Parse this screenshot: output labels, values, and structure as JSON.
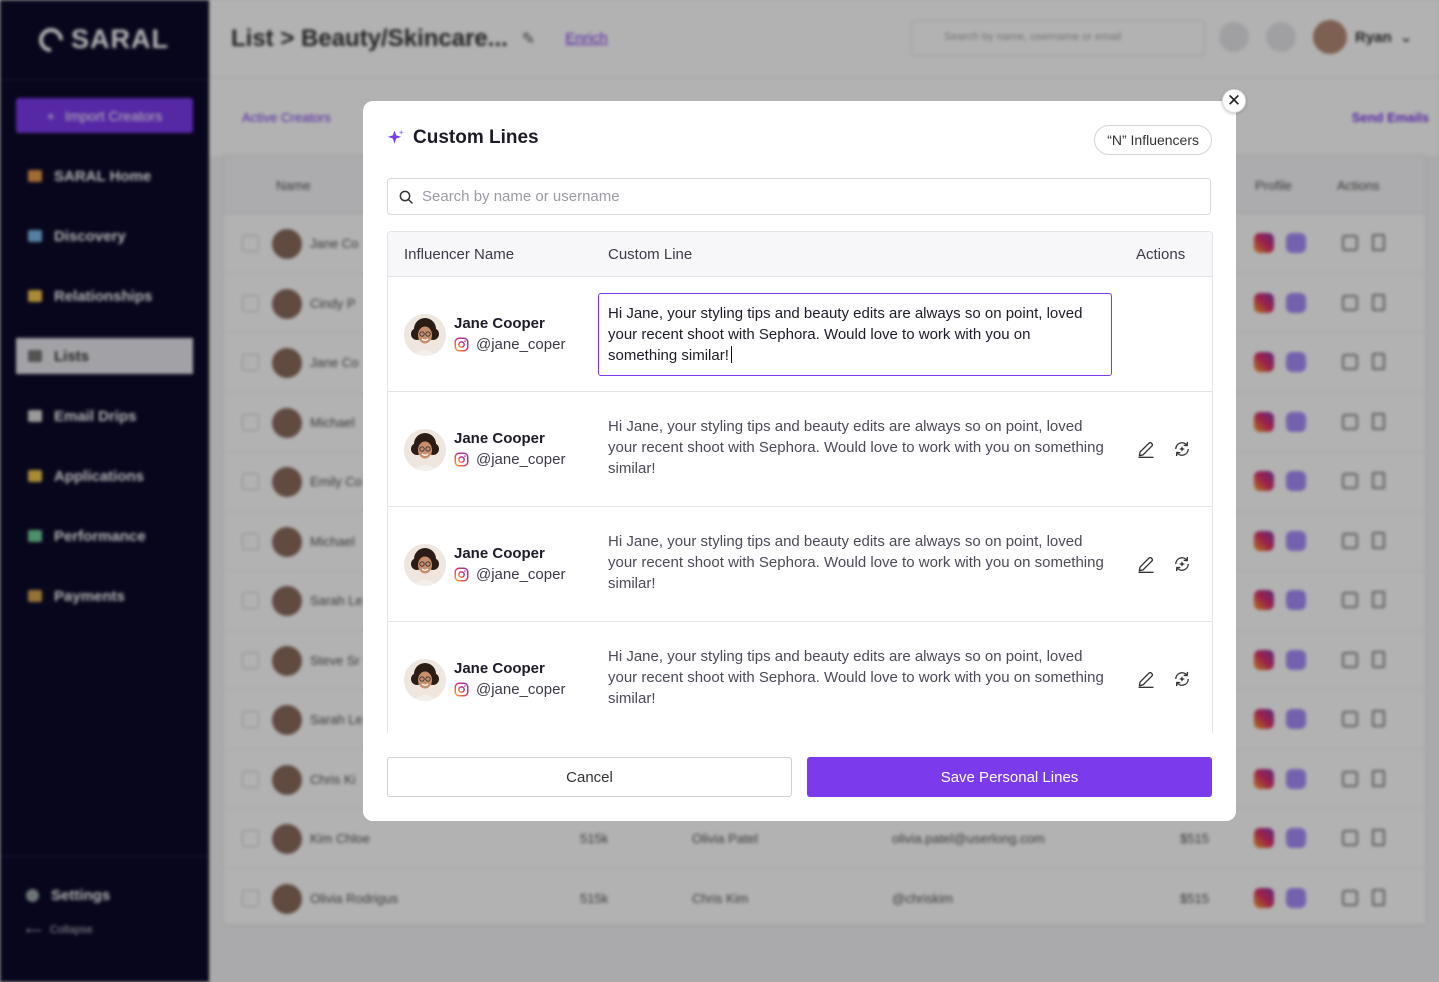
{
  "background": {
    "brand": "SARAL",
    "import_label": "Import Creators",
    "nav": [
      "SARAL Home",
      "Discovery",
      "Relationships",
      "Lists",
      "Email Drips",
      "Applications",
      "Performance",
      "Payments"
    ],
    "nav_active": "Lists",
    "settings": "Settings",
    "collapse": "Collapse",
    "breadcrumb": "List > Beauty/Skincare...",
    "enrich": "Enrich",
    "search_placeholder": "Search by name, username or email",
    "user": "Ryan",
    "tab_active": "Active Creators",
    "send_emails": "Send Emails",
    "headers": {
      "name": "Name",
      "profile": "Profile",
      "actions": "Actions"
    },
    "rows": [
      {
        "name": "Jane Co",
        "c2": "",
        "c3": "",
        "c4": "",
        "c5": ""
      },
      {
        "name": "Cindy P",
        "c2": "",
        "c3": "",
        "c4": "",
        "c5": ""
      },
      {
        "name": "Jane Co",
        "c2": "",
        "c3": "",
        "c4": "",
        "c5": ""
      },
      {
        "name": "Michael",
        "c2": "",
        "c3": "",
        "c4": "",
        "c5": ""
      },
      {
        "name": "Emily Co",
        "c2": "",
        "c3": "",
        "c4": "",
        "c5": ""
      },
      {
        "name": "Michael",
        "c2": "",
        "c3": "",
        "c4": "",
        "c5": ""
      },
      {
        "name": "Sarah Le",
        "c2": "",
        "c3": "",
        "c4": "",
        "c5": ""
      },
      {
        "name": "Steve Sr",
        "c2": "",
        "c3": "",
        "c4": "",
        "c5": ""
      },
      {
        "name": "Sarah Le",
        "c2": "",
        "c3": "",
        "c4": "",
        "c5": ""
      },
      {
        "name": "Chris Ki",
        "c2": "",
        "c3": "",
        "c4": "",
        "c5": ""
      },
      {
        "name": "Kim Chloe",
        "c2": "515k",
        "c3": "Olivia Patel",
        "c4": "olivia.patel@userlong.com",
        "c5": "$515"
      },
      {
        "name": "Olivia Rodrigus",
        "c2": "515k",
        "c3": "Chris Kim",
        "c4": "@chriskim",
        "c5": "$515"
      }
    ]
  },
  "modal": {
    "title": "Custom Lines",
    "badge": "“N” Influencers",
    "search_placeholder": "Search by name or username",
    "columns": {
      "name": "Influencer Name",
      "line": "Custom Line",
      "actions": "Actions"
    },
    "rows": [
      {
        "name": "Jane Cooper",
        "handle": "@jane_coper",
        "line": "Hi Jane, your styling tips and beauty edits are always so on point, loved your recent shoot with Sephora. Would love to work with you on something similar!",
        "editing": true
      },
      {
        "name": "Jane Cooper",
        "handle": "@jane_coper",
        "line": "Hi Jane, your styling tips and beauty edits are always so on point, loved your recent shoot with Sephora. Would love to work with you on something similar!",
        "editing": false
      },
      {
        "name": "Jane Cooper",
        "handle": "@jane_coper",
        "line": "Hi Jane, your styling tips and beauty edits are always so on point, loved your recent shoot with Sephora. Would love to work with you on something similar!",
        "editing": false
      },
      {
        "name": "Jane Cooper",
        "handle": "@jane_coper",
        "line": "Hi Jane, your styling tips and beauty edits are always so on point, loved your recent shoot with Sephora. Would love to work with you on something similar!",
        "editing": false
      }
    ],
    "cancel_label": "Cancel",
    "save_label": "Save Personal Lines",
    "close_glyph": "✕"
  },
  "colors": {
    "accent": "#7c3aed",
    "sidebar": "#0c0a2a"
  }
}
